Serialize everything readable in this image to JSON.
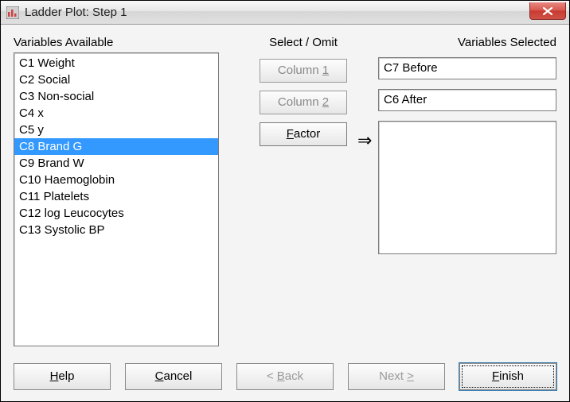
{
  "window": {
    "title": "Ladder Plot: Step 1"
  },
  "labels": {
    "available": "Variables Available",
    "select_omit": "Select / Omit",
    "selected": "Variables Selected"
  },
  "available": {
    "items": [
      {
        "label": "C1 Weight",
        "selected": false
      },
      {
        "label": "C2 Social",
        "selected": false
      },
      {
        "label": "C3 Non-social",
        "selected": false
      },
      {
        "label": "C4 x",
        "selected": false
      },
      {
        "label": "C5 y",
        "selected": false
      },
      {
        "label": "C8 Brand G",
        "selected": true
      },
      {
        "label": "C9 Brand W",
        "selected": false
      },
      {
        "label": "C10 Haemoglobin",
        "selected": false
      },
      {
        "label": "C11 Platelets",
        "selected": false
      },
      {
        "label": "C12 log Leucocytes",
        "selected": false
      },
      {
        "label": "C13 Systolic BP",
        "selected": false
      }
    ]
  },
  "select_buttons": {
    "column1_pre": "Column ",
    "column1_u": "1",
    "column2_pre": "Column ",
    "column2_u": "2",
    "factor_u": "F",
    "factor_post": "actor"
  },
  "selected": {
    "column1": "C7 Before",
    "column2": "C6 After",
    "factors": ""
  },
  "buttons": {
    "help_u": "H",
    "help_post": "elp",
    "cancel_u": "C",
    "cancel_post": "ancel",
    "back_pre": "< ",
    "back_u": "B",
    "back_post": "ack",
    "next_pre": "Next ",
    "next_u": ">",
    "finish_u": "F",
    "finish_post": "inish"
  }
}
